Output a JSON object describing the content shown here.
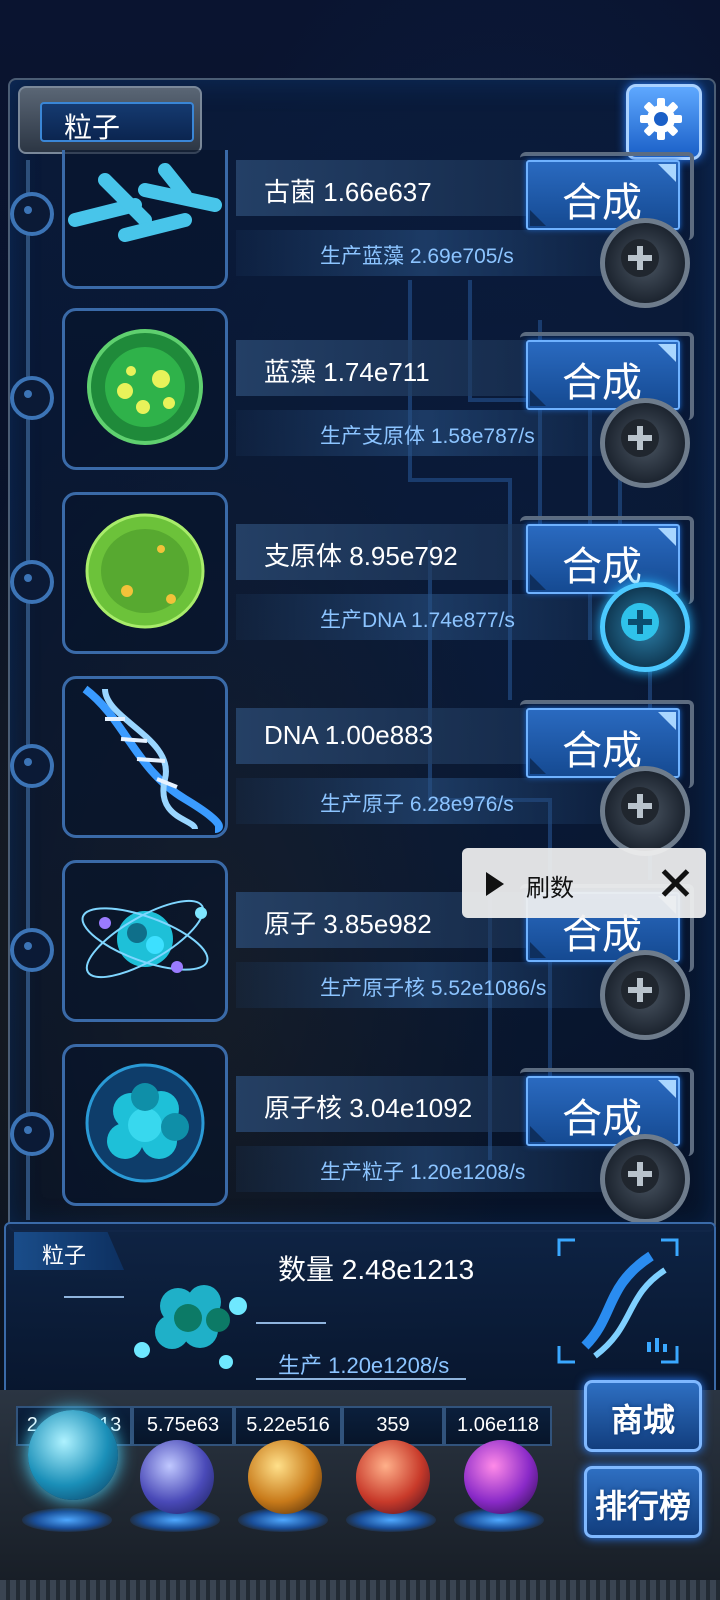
{
  "header": {
    "title": "粒子"
  },
  "merge_label": "合成",
  "items": [
    {
      "name": "古菌",
      "amount": "1.66e637",
      "production": "生产蓝藻 2.69e705/s"
    },
    {
      "name": "蓝藻",
      "amount": "1.74e711",
      "production": "生产支原体 1.58e787/s"
    },
    {
      "name": "支原体",
      "amount": "8.95e792",
      "production": "生产DNA 1.74e877/s"
    },
    {
      "name": "DNA",
      "amount": "1.00e883",
      "production": "生产原子 6.28e976/s"
    },
    {
      "name": "原子",
      "amount": "3.85e982",
      "production": "生产原子核 5.52e1086/s"
    },
    {
      "name": "原子核",
      "amount": "3.04e1092",
      "production": "生产粒子 1.20e1208/s"
    }
  ],
  "popup": {
    "label": "刷数"
  },
  "summary": {
    "tag": "粒子",
    "quantity": "数量 2.48e1213",
    "production": "生产 1.20e1208/s"
  },
  "dock": {
    "counters": [
      "2.48e1213",
      "5.75e63",
      "5.22e516",
      "359",
      "1.06e118"
    ],
    "shop_label": "商城",
    "rank_label": "排行榜"
  },
  "colors": {
    "accent": "#2a6ac0",
    "text_blue": "#8cc4ff"
  }
}
